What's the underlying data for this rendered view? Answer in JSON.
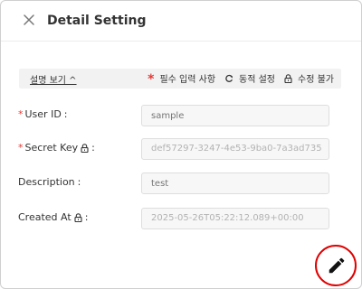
{
  "dialog": {
    "title": "Detail Setting"
  },
  "legend": {
    "toggle_label": "설명 보기 ^",
    "required_label": "필수 입력 사항",
    "dynamic_label": "동적 설정",
    "locked_label": "수정 불가"
  },
  "fields": {
    "user_id": {
      "label": "User ID",
      "placeholder": "sample",
      "required": true
    },
    "secret_key": {
      "label": "Secret Key",
      "value": "def57297-3247-4e53-9ba0-7a3ad735",
      "required": true
    },
    "description": {
      "label": "Description",
      "placeholder": "test"
    },
    "created_at": {
      "label": "Created At",
      "value": "2025-05-26T05:22:12.089+00:00"
    }
  },
  "colors": {
    "required": "#e53935",
    "edit_ring": "#e00000"
  }
}
